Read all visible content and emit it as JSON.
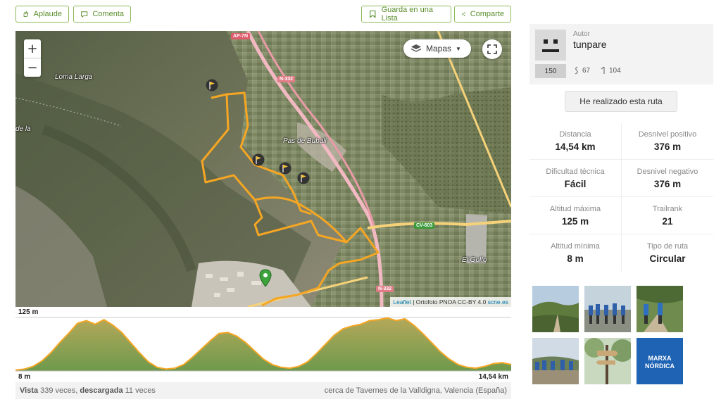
{
  "actions": {
    "applaud": "Aplaude",
    "comment": "Comenta",
    "save_list": "Guarda en una Lista",
    "share": "Comparte"
  },
  "map": {
    "zoom_in": "+",
    "zoom_out": "−",
    "layers_label": "Mapas",
    "attribution_link": "Leaflet",
    "attribution_text": " | Ortofoto PNOA CC-BY 4.0 ",
    "attribution_src": "scne.es",
    "labels": {
      "loma_larga": "Loma Larga",
      "pas_de_bubali": "Pas de Bubali",
      "de_la": "de la",
      "el_golfo": "El Golfo"
    },
    "roads": {
      "ap7n": "AP-7N",
      "n332_top": "N-332",
      "n332_bottom": "N-332",
      "cv603": "CV-603"
    }
  },
  "elevation": {
    "max_label": "125 m",
    "min_label": "8 m",
    "distance_label": "14,54 km",
    "profile": [
      10,
      12,
      18,
      30,
      48,
      70,
      90,
      112,
      118,
      110,
      120,
      108,
      92,
      70,
      48,
      28,
      16,
      12,
      14,
      22,
      38,
      56,
      74,
      90,
      92,
      84,
      70,
      52,
      34,
      22,
      16,
      14,
      18,
      28,
      46,
      66,
      86,
      100,
      106,
      110,
      118,
      120,
      124,
      118,
      122,
      108,
      90,
      70,
      50,
      34,
      22,
      16,
      14,
      18,
      24,
      26,
      22
    ]
  },
  "footer": {
    "view_label": "Vista",
    "view_text": " 339 veces, ",
    "download_label": "descargada",
    "download_text": " 11 veces",
    "location": "cerca de Tavernes de la Valldigna, Valencia (España)"
  },
  "author": {
    "label": "Autor",
    "name": "tunpare",
    "score": "150",
    "trails": "67",
    "followers": "104"
  },
  "done_button": "He realizado esta ruta",
  "stats": [
    {
      "label": "Distancia",
      "value": "14,54 km"
    },
    {
      "label": "Desnivel positivo",
      "value": "376 m"
    },
    {
      "label": "Dificultad técnica",
      "value": "Fácil"
    },
    {
      "label": "Desnivel negativo",
      "value": "376 m"
    },
    {
      "label": "Altitud máxima",
      "value": "125 m"
    },
    {
      "label": "Trailrank",
      "value": "21"
    },
    {
      "label": "Altitud mínima",
      "value": "8 m"
    },
    {
      "label": "Tipo de ruta",
      "value": "Circular"
    }
  ],
  "photos": {
    "p5_text_1": "MARXA",
    "p5_text_2": "NÓRDICA"
  },
  "colors": {
    "accent": "#5a8e2a",
    "route": "#f5a623",
    "elevation_fill": "#8ba55a"
  }
}
